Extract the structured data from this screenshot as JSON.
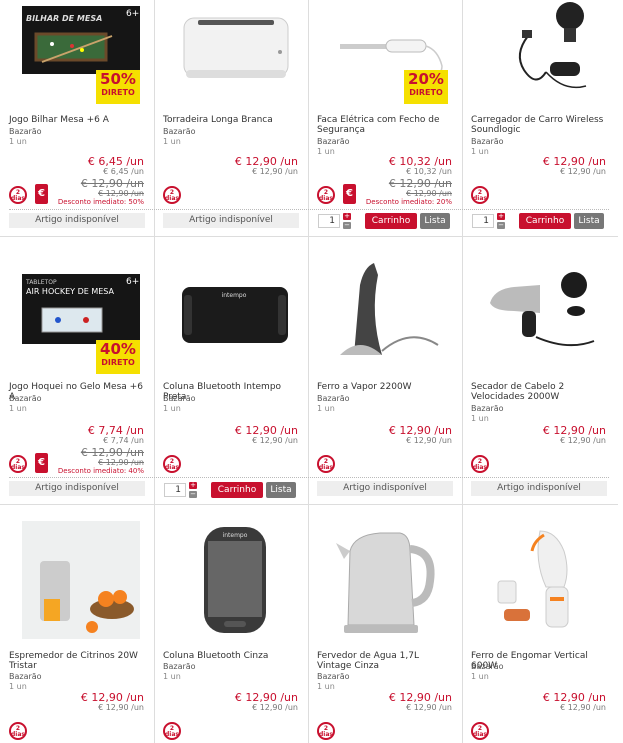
{
  "products": [
    {
      "name": "Jogo Bilhar Mesa +6 A",
      "brand": "Bazarão",
      "unit": "1 un",
      "price": "€ 6,45 /un",
      "price_sub": "€ 6,45 /un",
      "old_price": "€ 12,90 /un",
      "old_sub": "€ 12,90 /un",
      "discount": "Desconto imediato: 50%",
      "badge_pct": "50%",
      "badge_lbl": "DIRETO",
      "image_text": "BILHAR DE MESA",
      "image_age": "6+",
      "available": false,
      "euro": "€"
    },
    {
      "name": "Torradeira Longa Branca",
      "brand": "Bazarão",
      "unit": "1 un",
      "price": "€ 12,90 /un",
      "price_sub": "€ 12,90 /un",
      "available": false
    },
    {
      "name": "Faca Elétrica com Fecho de Segurança",
      "brand": "Bazarão",
      "unit": "1 un",
      "price": "€ 10,32 /un",
      "price_sub": "€ 10,32 /un",
      "old_price": "€ 12,90 /un",
      "old_sub": "€ 12,90 /un",
      "discount": "Desconto imediato: 20%",
      "badge_pct": "20%",
      "badge_lbl": "DIRETO",
      "available": true,
      "qty": "1",
      "euro": "€"
    },
    {
      "name": "Carregador de Carro Wireless Soundlogic",
      "brand": "Bazarão",
      "unit": "1 un",
      "price": "€ 12,90 /un",
      "price_sub": "€ 12,90 /un",
      "available": true,
      "qty": "1"
    },
    {
      "name": "Jogo Hoquei no Gelo Mesa +6 A",
      "brand": "Bazarão",
      "unit": "1 un",
      "price": "€ 7,74 /un",
      "price_sub": "€ 7,74 /un",
      "old_price": "€ 12,90 /un",
      "old_sub": "€ 12,90 /un",
      "discount": "Desconto imediato: 40%",
      "badge_pct": "40%",
      "badge_lbl": "DIRETO",
      "image_text": "AIR HOCKEY DE MESA",
      "image_top": "TABLETOP",
      "image_age": "6+",
      "available": false,
      "euro": "€"
    },
    {
      "name": "Coluna Bluetooth Intempo Preta",
      "brand": "Bazarão",
      "unit": "1 un",
      "price": "€ 12,90 /un",
      "price_sub": "€ 12,90 /un",
      "available": true,
      "qty": "1"
    },
    {
      "name": "Ferro a Vapor 2200W",
      "brand": "Bazarão",
      "unit": "1 un",
      "price": "€ 12,90 /un",
      "price_sub": "€ 12,90 /un",
      "available": false
    },
    {
      "name": "Secador de Cabelo 2 Velocidades 2000W",
      "brand": "Bazarão",
      "unit": "1 un",
      "price": "€ 12,90 /un",
      "price_sub": "€ 12,90 /un",
      "available": false
    },
    {
      "name": "Espremedor de Citrinos 20W Tristar",
      "brand": "Bazarão",
      "unit": "1 un",
      "price": "€ 12,90 /un",
      "price_sub": "€ 12,90 /un"
    },
    {
      "name": "Coluna Bluetooth Cinza",
      "brand": "Bazarão",
      "unit": "1 un",
      "price": "€ 12,90 /un",
      "price_sub": "€ 12,90 /un"
    },
    {
      "name": "Fervedor de Agua 1,7L Vintage Cinza",
      "brand": "Bazarão",
      "unit": "1 un",
      "price": "€ 12,90 /un",
      "price_sub": "€ 12,90 /un"
    },
    {
      "name": "Ferro de Engomar Vertical 600W",
      "brand": "Bazarão",
      "unit": "1 un",
      "price": "€ 12,90 /un",
      "price_sub": "€ 12,90 /un"
    }
  ],
  "labels": {
    "unavailable": "Artigo indisponível",
    "cart": "Carrinho",
    "list": "Lista",
    "dias_num": "2",
    "dias_text": "dias",
    "plus": "+",
    "minus": "−"
  },
  "colors": {
    "accent": "#c8102e",
    "badge": "#f5e000"
  }
}
